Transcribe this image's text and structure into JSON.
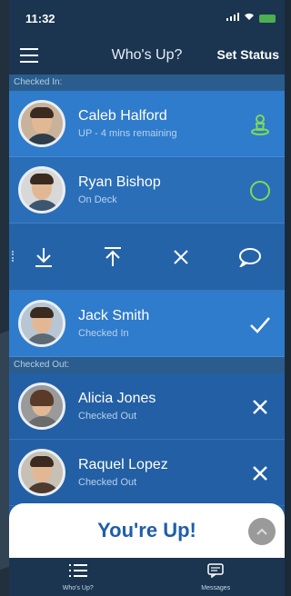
{
  "status_bar": {
    "time": "11:32",
    "signal": "▪▪▪",
    "wifi": "wifi-icon",
    "battery": "battery-icon"
  },
  "nav": {
    "title": "Who's Up?",
    "set_status": "Set Status"
  },
  "checked_in": {
    "header": "Checked In:",
    "rows": [
      {
        "name": "Caleb Halford",
        "status": "UP - 4 mins remaining",
        "action": "person-location-icon",
        "action_color": "#7ed957"
      },
      {
        "name": "Ryan Bishop",
        "status": "On Deck",
        "action": "circle-icon",
        "action_color": "#7ed957"
      }
    ],
    "actions": [
      "download-icon",
      "move-to-top-icon",
      "close-icon",
      "chat-bubble-icon"
    ],
    "after_actions": {
      "name": "Jack Smith",
      "status": "Checked In",
      "action": "checkmark-icon"
    }
  },
  "checked_out": {
    "header": "Checked Out:",
    "rows": [
      {
        "name": "Alicia Jones",
        "status": "Checked Out",
        "action": "close-icon"
      },
      {
        "name": "Raquel Lopez",
        "status": "Checked Out",
        "action": "close-icon"
      }
    ]
  },
  "toast": {
    "label": "You're Up!"
  },
  "tabs": [
    {
      "label": "Who's Up?",
      "icon": "list-icon"
    },
    {
      "label": "Messages",
      "icon": "message-icon"
    }
  ],
  "colors": {
    "primary": "#1f5ea8",
    "accent_green": "#7ed957",
    "nav": "#1b3550"
  }
}
